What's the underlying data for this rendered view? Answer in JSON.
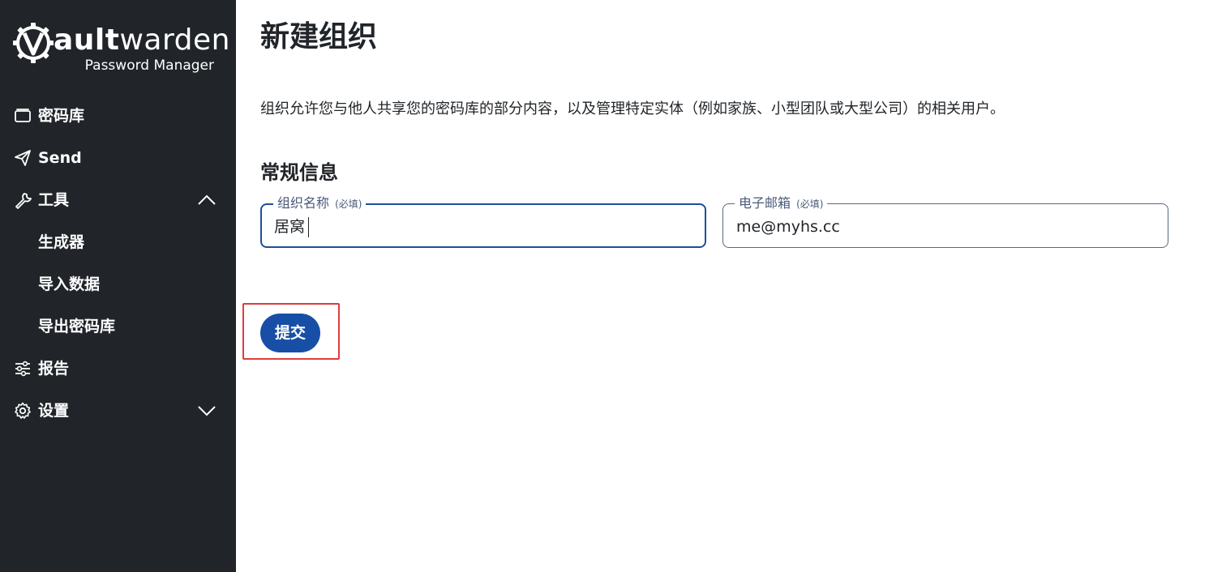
{
  "sidebar": {
    "logo": {
      "wordmark_bold": "ault",
      "wordmark_rest": "warden",
      "subtitle": "Password Manager",
      "icon": "vaultwarden-gear-icon"
    },
    "items": [
      {
        "label": "密码库",
        "icon": "vault-icon"
      },
      {
        "label": "Send",
        "icon": "send-icon"
      },
      {
        "label": "工具",
        "icon": "wrench-icon",
        "expanded": true
      },
      {
        "label": "生成器"
      },
      {
        "label": "导入数据"
      },
      {
        "label": "导出密码库"
      },
      {
        "label": "报告",
        "icon": "sliders-icon"
      },
      {
        "label": "设置",
        "icon": "gear-icon",
        "expanded": false
      }
    ]
  },
  "main": {
    "title": "新建组织",
    "description": "组织允许您与他人共享您的密码库的部分内容，以及管理特定实体（例如家族、小型团队或大型公司）的相关用户。",
    "section_title": "常规信息",
    "fields": {
      "org_name": {
        "label": "组织名称",
        "required": "(必填)",
        "value": "居窝"
      },
      "email": {
        "label": "电子邮箱",
        "required": "(必填)",
        "value": "me@myhs.cc"
      }
    },
    "submit_label": "提交"
  },
  "colors": {
    "sidebar_bg": "#212529",
    "primary": "#174ea6",
    "highlight": "#e03c3c"
  }
}
